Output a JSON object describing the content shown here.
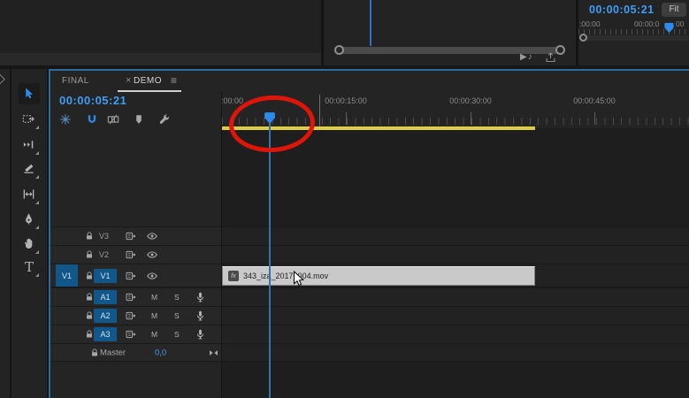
{
  "colors": {
    "accent_blue": "#2d8ceb",
    "timecode_blue": "#3f9df6",
    "track_target_blue": "#11578a",
    "focus_border_blue": "#2b6a9b",
    "work_area_yellow": "#ddce3d",
    "annotation_red": "#de1508",
    "clip_fill_gray": "#c9c9c9"
  },
  "monitor": {
    "timecode": "00:00:05:21",
    "zoom_select": "Fit",
    "ruler_label_start": ":00:00",
    "ruler_label_mid_before": "00:00:0",
    "ruler_label_mid_after": "00",
    "icons": [
      "play-around-icon",
      "export-frame-icon"
    ]
  },
  "timeline": {
    "tabs": [
      {
        "label": "FINAL",
        "close": "×",
        "active": false
      },
      {
        "label": "DEMO",
        "menu": "≡",
        "active": true
      }
    ],
    "timecode": "00:00:05:21",
    "toolbar_icons": [
      "nest-sequences-icon",
      "snap-magnet-icon",
      "linked-selection-icon",
      "add-marker-icon",
      "timeline-settings-wrench-icon"
    ],
    "ruler_labels": [
      ":00:00",
      "00:00:15:00",
      "00:00:30:00",
      "00:00:45:00"
    ],
    "tracks": {
      "video": [
        {
          "label": "V3",
          "targeted": false
        },
        {
          "label": "V2",
          "targeted": false
        },
        {
          "label": "V1",
          "targeted": true,
          "source_patch": "V1"
        }
      ],
      "audio": [
        {
          "label": "A1"
        },
        {
          "label": "A2"
        },
        {
          "label": "A3"
        }
      ],
      "audio_buttons": {
        "mute": "M",
        "solo": "S"
      },
      "master": {
        "label": "Master",
        "volume": "0,0"
      }
    },
    "clip": {
      "badge": "fx",
      "name": "343_iza_2017_004.mov"
    }
  },
  "tools": [
    "selection",
    "track-select-forward",
    "ripple-edit",
    "razor",
    "slip",
    "pen",
    "hand",
    "type"
  ],
  "type_tool_glyph": "T"
}
